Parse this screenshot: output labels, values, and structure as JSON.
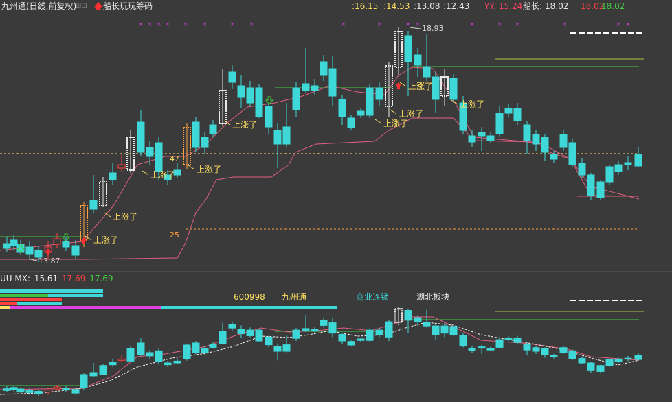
{
  "header": {
    "title": "九州通(日线,前复权)",
    "badge": "⊞⊡",
    "strategy": "船长玩玩筹码",
    "q1": ":16.15",
    "q2": ":14.53",
    "q3": ":13.08",
    "q4": ":12.43",
    "yy_label": "YY: 15.24",
    "cz_label": "船长:",
    "cz1": "18.02",
    "cz2": "18.02",
    "cz3": "18.02"
  },
  "sub": {
    "label": "UU  MX:",
    "v1": "15.61",
    "v2": "17.69",
    "v3": "17.69"
  },
  "overlay": {
    "code": "600998",
    "name": "九州通",
    "tag1": "商业连锁",
    "tag2": "湖北板块"
  },
  "colors": {
    "bg": "#3a3a3a",
    "up": "#ff4040",
    "down": "#3ed8d8",
    "white": "#e8e8e8",
    "yellow": "#ffe060",
    "pink": "#e040e0",
    "green": "#40d040",
    "orange": "#ffa040"
  },
  "chart_data": {
    "type": "candlestick",
    "period": "daily",
    "ref_levels": [
      47,
      25
    ],
    "annotations": {
      "high": "18.93",
      "low": "13.87",
      "signal": "上涨了"
    },
    "main_price_labels": [
      "47",
      "25"
    ]
  }
}
